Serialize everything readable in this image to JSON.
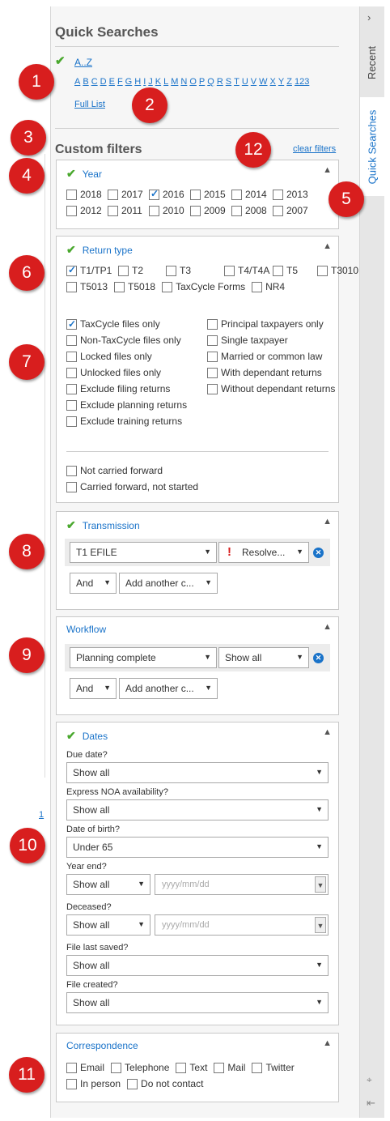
{
  "quick_searches": {
    "title": "Quick Searches",
    "az_label": "A..Z",
    "letters": [
      "A",
      "B",
      "C",
      "D",
      "E",
      "F",
      "G",
      "H",
      "I",
      "J",
      "K",
      "L",
      "M",
      "N",
      "O",
      "P",
      "Q",
      "R",
      "S",
      "T",
      "U",
      "V",
      "W",
      "X",
      "Y",
      "Z",
      "123"
    ],
    "full_list": "Full List"
  },
  "side_tabs": {
    "recent": "Recent",
    "quick_searches": "Quick Searches"
  },
  "custom_filters": {
    "title": "Custom filters",
    "clear": "clear filters"
  },
  "year": {
    "title": "Year",
    "items": [
      {
        "label": "2018",
        "checked": false
      },
      {
        "label": "2017",
        "checked": false
      },
      {
        "label": "2016",
        "checked": true
      },
      {
        "label": "2015",
        "checked": false
      },
      {
        "label": "2014",
        "checked": false
      },
      {
        "label": "2013",
        "checked": false
      },
      {
        "label": "2012",
        "checked": false
      },
      {
        "label": "2011",
        "checked": false
      },
      {
        "label": "2010",
        "checked": false
      },
      {
        "label": "2009",
        "checked": false
      },
      {
        "label": "2008",
        "checked": false
      },
      {
        "label": "2007",
        "checked": false
      }
    ]
  },
  "return_type": {
    "title": "Return type",
    "types": [
      "T1/TP1",
      "T2",
      "T3",
      "T4/T4A",
      "T5",
      "T3010",
      "T5013",
      "T5018",
      "TaxCycle Forms",
      "NR4"
    ],
    "left_options": [
      "TaxCycle files only",
      "Non-TaxCycle files only",
      "Locked files only",
      "Unlocked files only",
      "Exclude filing returns",
      "Exclude planning returns",
      "Exclude training returns"
    ],
    "right_options": [
      "Principal taxpayers only",
      "Single taxpayer",
      "Married or common law",
      "With dependant returns",
      "Without dependant returns"
    ],
    "carry": [
      "Not carried forward",
      "Carried forward, not started"
    ]
  },
  "transmission": {
    "title": "Transmission",
    "field": "T1 EFILE",
    "status": "Resolve...",
    "and": "And",
    "add": "Add another c..."
  },
  "workflow": {
    "title": "Workflow",
    "field": "Planning complete",
    "status": "Show all",
    "and": "And",
    "add": "Add another c..."
  },
  "dates": {
    "title": "Dates",
    "due_label": "Due date?",
    "due_value": "Show all",
    "noa_label": "Express NOA availability?",
    "noa_value": "Show all",
    "dob_label": "Date of birth?",
    "dob_value": "Under 65",
    "ye_label": "Year end?",
    "ye_value": "Show all",
    "ye_placeholder": "yyyy/mm/dd",
    "dec_label": "Deceased?",
    "dec_value": "Show all",
    "dec_placeholder": "yyyy/mm/dd",
    "saved_label": "File last saved?",
    "saved_value": "Show all",
    "created_label": "File created?",
    "created_value": "Show all"
  },
  "correspondence": {
    "title": "Correspondence",
    "items": [
      "Email",
      "Telephone",
      "Text",
      "Mail",
      "Twitter",
      "In person",
      "Do not contact"
    ]
  },
  "callouts": [
    "1",
    "2",
    "3",
    "4",
    "5",
    "6",
    "7",
    "8",
    "9",
    "10",
    "11",
    "12"
  ],
  "left_fragment": "1",
  "colors": {
    "accent": "#1a73c9",
    "check": "#4aa82e",
    "callout": "#d81e1e"
  }
}
